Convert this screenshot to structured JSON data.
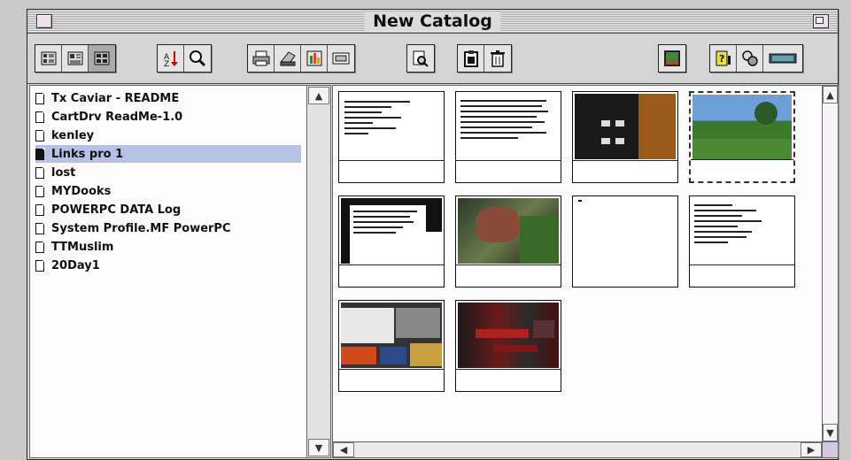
{
  "window": {
    "title": "New Catalog"
  },
  "toolbar": {
    "groups": [
      {
        "name": "view-modes",
        "buttons": [
          "list-view-icon",
          "detail-view-icon",
          "thumbnail-view-icon"
        ]
      },
      {
        "name": "sort-find",
        "buttons": [
          "sort-icon",
          "find-magnifier-icon"
        ]
      },
      {
        "name": "catalog-tools",
        "buttons": [
          "print-icon",
          "scan-icon",
          "slideshow-icon",
          "preview-icon"
        ]
      },
      {
        "name": "open",
        "buttons": [
          "open-viewer-icon"
        ]
      },
      {
        "name": "clipboard",
        "buttons": [
          "paste-icon",
          "trash-icon"
        ]
      },
      {
        "name": "image",
        "buttons": [
          "image-icon"
        ]
      },
      {
        "name": "info",
        "buttons": [
          "help-icon",
          "settings-icon",
          "memory-icon"
        ]
      }
    ],
    "active_view": "thumbnail-view-icon"
  },
  "file_list": {
    "items": [
      {
        "label": "Tx Caviar - README",
        "selected": false
      },
      {
        "label": "CartDrv ReadMe-1.0",
        "selected": false
      },
      {
        "label": "kenley",
        "selected": false
      },
      {
        "label": "Links pro 1",
        "selected": true
      },
      {
        "label": "lost",
        "selected": false
      },
      {
        "label": "MYDooks",
        "selected": false
      },
      {
        "label": "POWERPC DATA Log",
        "selected": false
      },
      {
        "label": "System Profile.MF PowerPC",
        "selected": false
      },
      {
        "label": "TTMuslim",
        "selected": false
      },
      {
        "label": "20Day1",
        "selected": false
      }
    ]
  },
  "thumbnails": {
    "items": [
      {
        "kind": "text-doc",
        "selected": false
      },
      {
        "kind": "text-doc",
        "selected": false
      },
      {
        "kind": "dark-ui",
        "selected": false
      },
      {
        "kind": "landscape",
        "selected": true
      },
      {
        "kind": "text-panel",
        "selected": false
      },
      {
        "kind": "nature-photo",
        "selected": false
      },
      {
        "kind": "blank",
        "selected": false
      },
      {
        "kind": "text-list",
        "selected": false
      },
      {
        "kind": "screen-grab",
        "selected": false
      },
      {
        "kind": "red-noise",
        "selected": false
      }
    ]
  },
  "colors": {
    "selection": "#b3c2e6",
    "window_bg": "#dcdcdc",
    "accent_purple": "#d6c8e0"
  }
}
